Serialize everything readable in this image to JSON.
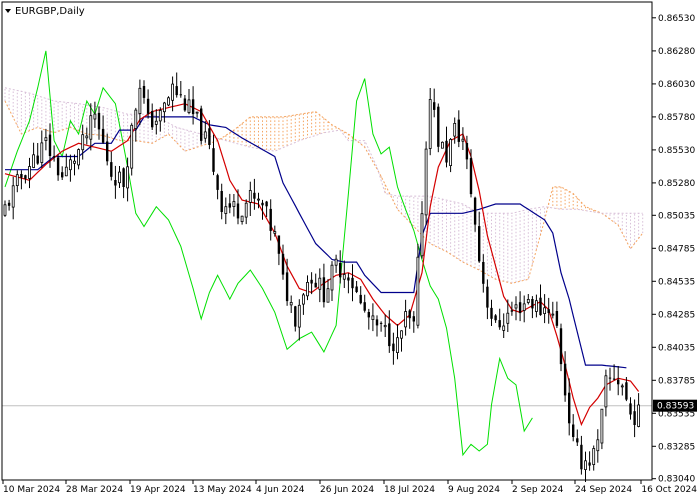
{
  "chart_data": {
    "type": "candlestick",
    "title": "EURGBP,Daily",
    "symbol": "EURGBP",
    "timeframe": "Daily",
    "current_price": "0.83593",
    "current_price_value": 0.83593,
    "ylim": [
      0.8303,
      0.8665
    ],
    "yticks": [
      "0.86530",
      "0.86280",
      "0.86030",
      "0.85780",
      "0.85530",
      "0.85280",
      "0.85035",
      "0.84785",
      "0.84535",
      "0.84285",
      "0.84035",
      "0.83785",
      "0.83535",
      "0.83285",
      "0.83040"
    ],
    "xticks": [
      "10 Mar 2024",
      "28 Mar 2024",
      "19 Apr 2024",
      "13 May 2024",
      "4 Jun 2024",
      "26 Jun 2024",
      "18 Jul 2024",
      "9 Aug 2024",
      "2 Sep 2024",
      "24 Sep 2024",
      "16 Oct 2024"
    ],
    "bar_count": 156,
    "indicator": "Ichimoku Kinko Hyo",
    "colors": {
      "background": "#ffffff",
      "axis": "#000000",
      "candle": "#000000",
      "tenkan": "#d40000",
      "kijun": "#00008b",
      "chikou": "#00e000",
      "senkou_a": "#f4a460",
      "senkou_b": "#d8bfd8",
      "price_line": "#c0c0c0",
      "price_label_bg": "#000000"
    },
    "close_anchors": [
      [
        0,
        0.8509
      ],
      [
        4,
        0.8533
      ],
      [
        10,
        0.8558
      ],
      [
        14,
        0.8532
      ],
      [
        19,
        0.8557
      ],
      [
        22,
        0.8578
      ],
      [
        26,
        0.8536
      ],
      [
        29,
        0.8528
      ],
      [
        31,
        0.8568
      ],
      [
        33,
        0.8605
      ],
      [
        35,
        0.8574
      ],
      [
        38,
        0.8578
      ],
      [
        41,
        0.86
      ],
      [
        44,
        0.8588
      ],
      [
        47,
        0.8574
      ],
      [
        50,
        0.8553
      ],
      [
        53,
        0.8512
      ],
      [
        57,
        0.8508
      ],
      [
        60,
        0.8516
      ],
      [
        63,
        0.851
      ],
      [
        66,
        0.8487
      ],
      [
        68,
        0.8453
      ],
      [
        71,
        0.8427
      ],
      [
        73,
        0.8448
      ],
      [
        75,
        0.8458
      ],
      [
        78,
        0.8445
      ],
      [
        81,
        0.8465
      ],
      [
        84,
        0.846
      ],
      [
        87,
        0.8435
      ],
      [
        90,
        0.842
      ],
      [
        93,
        0.8415
      ],
      [
        96,
        0.8405
      ],
      [
        98,
        0.8425
      ],
      [
        100,
        0.8418
      ],
      [
        102,
        0.851
      ],
      [
        104,
        0.8598
      ],
      [
        106,
        0.856
      ],
      [
        108,
        0.8548
      ],
      [
        110,
        0.8568
      ],
      [
        112,
        0.856
      ],
      [
        114,
        0.8522
      ],
      [
        116,
        0.847
      ],
      [
        118,
        0.8438
      ],
      [
        120,
        0.8418
      ],
      [
        123,
        0.8428
      ],
      [
        126,
        0.8435
      ],
      [
        128,
        0.844
      ],
      [
        131,
        0.8432
      ],
      [
        133,
        0.8435
      ],
      [
        135,
        0.8418
      ],
      [
        137,
        0.837
      ],
      [
        139,
        0.833
      ],
      [
        141,
        0.8318
      ],
      [
        143,
        0.8318
      ],
      [
        145,
        0.8328
      ],
      [
        147,
        0.8375
      ],
      [
        149,
        0.8382
      ],
      [
        151,
        0.8375
      ],
      [
        153,
        0.8352
      ],
      [
        155,
        0.8352
      ]
    ],
    "tenkan_anchors": [
      [
        0,
        0.8535
      ],
      [
        6,
        0.853
      ],
      [
        10,
        0.8542
      ],
      [
        14,
        0.8552
      ],
      [
        18,
        0.8558
      ],
      [
        22,
        0.8555
      ],
      [
        26,
        0.8552
      ],
      [
        30,
        0.856
      ],
      [
        33,
        0.8576
      ],
      [
        36,
        0.8582
      ],
      [
        40,
        0.8585
      ],
      [
        44,
        0.8588
      ],
      [
        48,
        0.8582
      ],
      [
        52,
        0.856
      ],
      [
        55,
        0.853
      ],
      [
        58,
        0.8515
      ],
      [
        62,
        0.8512
      ],
      [
        66,
        0.849
      ],
      [
        69,
        0.8465
      ],
      [
        72,
        0.8448
      ],
      [
        75,
        0.8445
      ],
      [
        78,
        0.8452
      ],
      [
        81,
        0.8458
      ],
      [
        84,
        0.846
      ],
      [
        87,
        0.8455
      ],
      [
        90,
        0.844
      ],
      [
        93,
        0.8428
      ],
      [
        96,
        0.842
      ],
      [
        99,
        0.8428
      ],
      [
        102,
        0.846
      ],
      [
        104,
        0.851
      ],
      [
        106,
        0.854
      ],
      [
        109,
        0.856
      ],
      [
        112,
        0.8565
      ],
      [
        114,
        0.8548
      ],
      [
        116,
        0.8522
      ],
      [
        118,
        0.8488
      ],
      [
        120,
        0.8465
      ],
      [
        122,
        0.8442
      ],
      [
        124,
        0.8432
      ],
      [
        126,
        0.843
      ],
      [
        129,
        0.8435
      ],
      [
        131,
        0.8438
      ],
      [
        133,
        0.8432
      ],
      [
        135,
        0.8412
      ],
      [
        137,
        0.839
      ],
      [
        139,
        0.8365
      ],
      [
        141,
        0.8345
      ],
      [
        143,
        0.8358
      ],
      [
        145,
        0.8365
      ],
      [
        147,
        0.8375
      ],
      [
        150,
        0.838
      ],
      [
        153,
        0.8378
      ],
      [
        155,
        0.837
      ]
    ],
    "kijun_anchors": [
      [
        0,
        0.8538
      ],
      [
        8,
        0.8538
      ],
      [
        12,
        0.8548
      ],
      [
        18,
        0.8548
      ],
      [
        22,
        0.8558
      ],
      [
        26,
        0.8558
      ],
      [
        28,
        0.8568
      ],
      [
        32,
        0.8568
      ],
      [
        34,
        0.8578
      ],
      [
        46,
        0.8578
      ],
      [
        50,
        0.8572
      ],
      [
        54,
        0.857
      ],
      [
        58,
        0.8562
      ],
      [
        62,
        0.8555
      ],
      [
        66,
        0.8548
      ],
      [
        68,
        0.8528
      ],
      [
        72,
        0.8505
      ],
      [
        76,
        0.8482
      ],
      [
        80,
        0.847
      ],
      [
        83,
        0.8468
      ],
      [
        86,
        0.8468
      ],
      [
        88,
        0.8458
      ],
      [
        92,
        0.8445
      ],
      [
        96,
        0.8445
      ],
      [
        100,
        0.8445
      ],
      [
        102,
        0.8488
      ],
      [
        104,
        0.8505
      ],
      [
        112,
        0.8505
      ],
      [
        116,
        0.8508
      ],
      [
        120,
        0.8512
      ],
      [
        126,
        0.8512
      ],
      [
        132,
        0.85
      ],
      [
        134,
        0.849
      ],
      [
        136,
        0.846
      ],
      [
        138,
        0.844
      ],
      [
        140,
        0.8415
      ],
      [
        142,
        0.839
      ],
      [
        146,
        0.839
      ],
      [
        152,
        0.8388
      ]
    ],
    "chikou_anchors": [
      [
        0,
        0.8525
      ],
      [
        3,
        0.8552
      ],
      [
        6,
        0.8575
      ],
      [
        8,
        0.86
      ],
      [
        10,
        0.8628
      ],
      [
        12,
        0.856
      ],
      [
        14,
        0.8548
      ],
      [
        16,
        0.8575
      ],
      [
        18,
        0.8565
      ],
      [
        20,
        0.859
      ],
      [
        22,
        0.858
      ],
      [
        24,
        0.86
      ],
      [
        27,
        0.8588
      ],
      [
        30,
        0.854
      ],
      [
        32,
        0.8505
      ],
      [
        34,
        0.8495
      ],
      [
        37,
        0.851
      ],
      [
        40,
        0.85
      ],
      [
        43,
        0.848
      ],
      [
        46,
        0.8448
      ],
      [
        48,
        0.8425
      ],
      [
        50,
        0.8445
      ],
      [
        52,
        0.8458
      ],
      [
        55,
        0.844
      ],
      [
        57,
        0.8452
      ],
      [
        60,
        0.8462
      ],
      [
        63,
        0.8448
      ],
      [
        66,
        0.843
      ],
      [
        69,
        0.8402
      ],
      [
        72,
        0.841
      ],
      [
        75,
        0.8415
      ],
      [
        78,
        0.84
      ],
      [
        81,
        0.842
      ],
      [
        84,
        0.852
      ],
      [
        86,
        0.859
      ],
      [
        88,
        0.8607
      ],
      [
        90,
        0.8565
      ],
      [
        92,
        0.855
      ],
      [
        94,
        0.8555
      ],
      [
        96,
        0.8525
      ],
      [
        98,
        0.8508
      ],
      [
        100,
        0.8492
      ],
      [
        102,
        0.847
      ],
      [
        104,
        0.845
      ],
      [
        106,
        0.844
      ],
      [
        108,
        0.8418
      ],
      [
        110,
        0.838
      ],
      [
        112,
        0.8322
      ],
      [
        114,
        0.833
      ],
      [
        116,
        0.8325
      ],
      [
        118,
        0.833
      ],
      [
        119,
        0.836
      ],
      [
        121,
        0.8395
      ],
      [
        123,
        0.838
      ],
      [
        125,
        0.8375
      ],
      [
        127,
        0.834
      ],
      [
        129,
        0.835
      ]
    ],
    "senkou_a_anchors": [
      [
        0,
        0.859
      ],
      [
        4,
        0.8565
      ],
      [
        8,
        0.857
      ],
      [
        12,
        0.8566
      ],
      [
        16,
        0.857
      ],
      [
        20,
        0.8565
      ],
      [
        24,
        0.8564
      ],
      [
        28,
        0.856
      ],
      [
        32,
        0.856
      ],
      [
        36,
        0.8558
      ],
      [
        40,
        0.8565
      ],
      [
        44,
        0.8552
      ],
      [
        48,
        0.8556
      ],
      [
        52,
        0.856
      ],
      [
        56,
        0.8568
      ],
      [
        60,
        0.8578
      ],
      [
        64,
        0.8578
      ],
      [
        68,
        0.8578
      ],
      [
        72,
        0.858
      ],
      [
        76,
        0.8582
      ],
      [
        80,
        0.8572
      ],
      [
        84,
        0.8565
      ],
      [
        88,
        0.8555
      ],
      [
        92,
        0.8533
      ],
      [
        96,
        0.8508
      ],
      [
        100,
        0.8495
      ],
      [
        104,
        0.8482
      ],
      [
        108,
        0.8476
      ],
      [
        112,
        0.8468
      ],
      [
        116,
        0.8462
      ],
      [
        120,
        0.8455
      ],
      [
        124,
        0.8452
      ],
      [
        128,
        0.8455
      ],
      [
        132,
        0.85
      ],
      [
        134,
        0.8525
      ],
      [
        136,
        0.8525
      ],
      [
        139,
        0.852
      ],
      [
        142,
        0.851
      ],
      [
        146,
        0.8505
      ],
      [
        150,
        0.8496
      ],
      [
        153,
        0.8478
      ],
      [
        156,
        0.849
      ]
    ],
    "senkou_b_anchors": [
      [
        0,
        0.86
      ],
      [
        6,
        0.8596
      ],
      [
        12,
        0.859
      ],
      [
        18,
        0.8588
      ],
      [
        24,
        0.8585
      ],
      [
        30,
        0.858
      ],
      [
        36,
        0.858
      ],
      [
        42,
        0.857
      ],
      [
        48,
        0.8565
      ],
      [
        54,
        0.856
      ],
      [
        60,
        0.8555
      ],
      [
        66,
        0.8552
      ],
      [
        72,
        0.856
      ],
      [
        78,
        0.8566
      ],
      [
        82,
        0.8568
      ],
      [
        84,
        0.856
      ],
      [
        88,
        0.856
      ],
      [
        91,
        0.854
      ],
      [
        93,
        0.852
      ],
      [
        96,
        0.8518
      ],
      [
        100,
        0.8518
      ],
      [
        104,
        0.8518
      ],
      [
        108,
        0.8515
      ],
      [
        112,
        0.8512
      ],
      [
        116,
        0.8505
      ],
      [
        120,
        0.8505
      ],
      [
        124,
        0.8505
      ],
      [
        128,
        0.8508
      ],
      [
        132,
        0.851
      ],
      [
        136,
        0.8508
      ],
      [
        140,
        0.8508
      ],
      [
        146,
        0.8505
      ],
      [
        152,
        0.8505
      ],
      [
        156,
        0.8505
      ]
    ]
  }
}
